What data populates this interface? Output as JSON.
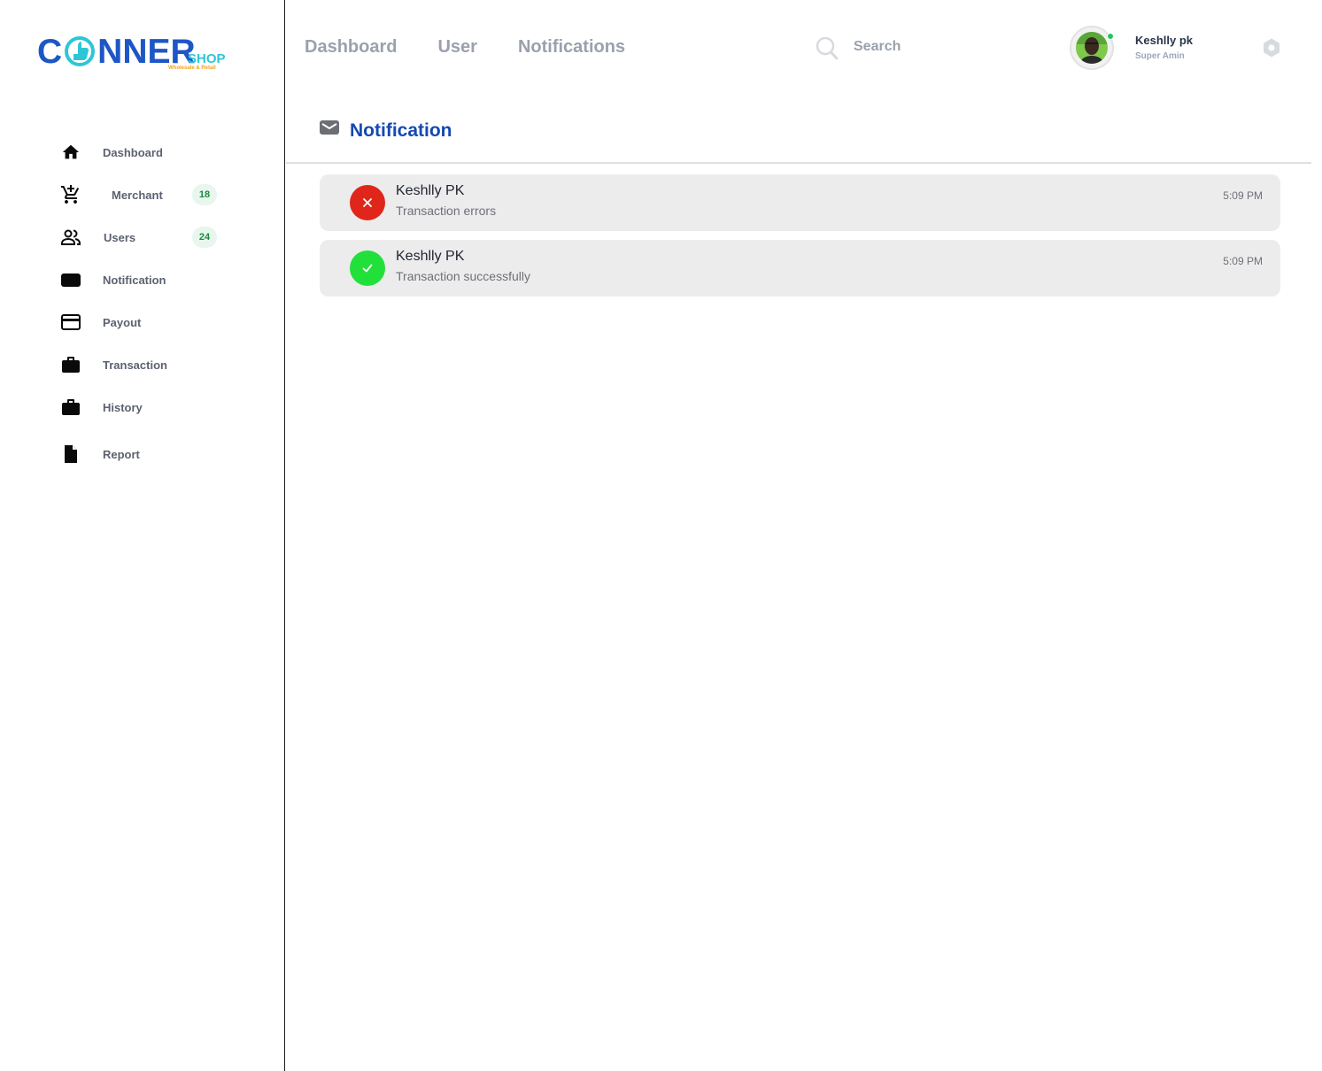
{
  "brand": {
    "name": "CONNER",
    "sub": "SHOP",
    "tagline": "Wholesale & Retail",
    "primary_color": "#1e56c6",
    "accent_color": "#2ec6d6",
    "tagline_color": "#f2a21d"
  },
  "sidebar": {
    "items": [
      {
        "label": "Dashboard",
        "icon": "home-icon"
      },
      {
        "label": "Merchant",
        "icon": "cart-add-icon",
        "badge": "18"
      },
      {
        "label": "Users",
        "icon": "users-icon",
        "badge": "24"
      },
      {
        "label": "Notification",
        "icon": "notification-icon"
      },
      {
        "label": "Payout",
        "icon": "credit-card-icon"
      },
      {
        "label": "Transaction",
        "icon": "briefcase-icon"
      },
      {
        "label": "History",
        "icon": "briefcase-icon"
      },
      {
        "label": "Report",
        "icon": "file-icon"
      }
    ]
  },
  "header": {
    "nav": [
      "Dashboard",
      "User",
      "Notifications"
    ],
    "search": {
      "placeholder": "Search"
    },
    "user": {
      "name": "Keshlly pk",
      "role": "Super Amin",
      "online": true
    },
    "settings_icon": "gear-icon"
  },
  "main": {
    "title": "Notification",
    "title_icon": "envelope-icon",
    "notifications": [
      {
        "name": "Keshlly PK",
        "message": "Transaction errors",
        "time": "5:09 PM",
        "status": "error",
        "status_color": "#e0261b"
      },
      {
        "name": "Keshlly PK",
        "message": "Transaction successfully",
        "time": "5:09 PM",
        "status": "success",
        "status_color": "#22e03a"
      }
    ]
  }
}
